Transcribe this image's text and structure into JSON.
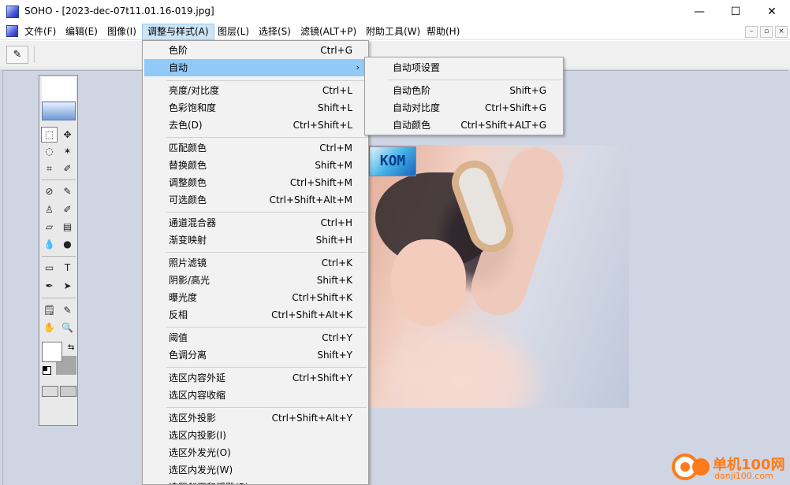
{
  "window": {
    "title": "SOHO - [2023-dec-07t11.01.16-019.jpg]",
    "minimize_glyph": "—",
    "maximize_glyph": "☐",
    "close_glyph": "✕"
  },
  "menubar": {
    "items": [
      {
        "label": "文件(F)"
      },
      {
        "label": "编辑(E)"
      },
      {
        "label": "图像(I)"
      },
      {
        "label": "调整与样式(A)",
        "active": true
      },
      {
        "label": "图层(L)"
      },
      {
        "label": "选择(S)"
      },
      {
        "label": "滤镜(ALT+P)"
      },
      {
        "label": "附助工具(W)"
      },
      {
        "label": "帮助(H)"
      }
    ],
    "mdi_minimize": "–",
    "mdi_restore": "▫",
    "mdi_close": "×"
  },
  "toolbar": {
    "tool_options_icon": "eyedropper-icon",
    "tool_options_glyph": "✎"
  },
  "toolbox": {
    "tools": [
      {
        "name": "rect-marquee-icon",
        "glyph": "⬚"
      },
      {
        "name": "move-icon",
        "glyph": "✥"
      },
      {
        "name": "lasso-icon",
        "glyph": "◌"
      },
      {
        "name": "magic-wand-icon",
        "glyph": "✶"
      },
      {
        "name": "crop-icon",
        "glyph": "⌗"
      },
      {
        "name": "color-sampler-icon",
        "glyph": "✐"
      },
      {
        "name": "healing-brush-icon",
        "glyph": "⊘"
      },
      {
        "name": "brush-icon",
        "glyph": "✎"
      },
      {
        "name": "clone-stamp-icon",
        "glyph": "♙"
      },
      {
        "name": "history-brush-icon",
        "glyph": "✐"
      },
      {
        "name": "eraser-icon",
        "glyph": "▱"
      },
      {
        "name": "gradient-icon",
        "glyph": "▤"
      },
      {
        "name": "blur-icon",
        "glyph": "💧"
      },
      {
        "name": "dodge-icon",
        "glyph": "●"
      },
      {
        "name": "shape-icon",
        "glyph": "▭"
      },
      {
        "name": "type-icon",
        "glyph": "T"
      },
      {
        "name": "pen-icon",
        "glyph": "✒"
      },
      {
        "name": "direct-select-icon",
        "glyph": "➤"
      },
      {
        "name": "notes-icon",
        "glyph": "🗒"
      },
      {
        "name": "eyedropper-icon",
        "glyph": "✎"
      },
      {
        "name": "hand-icon",
        "glyph": "✋"
      },
      {
        "name": "zoom-icon",
        "glyph": "🔍"
      }
    ],
    "swap_glyph": "⇆"
  },
  "dropdown": {
    "groups": [
      [
        {
          "label": "色阶",
          "shortcut": "Ctrl+G"
        },
        {
          "label": "自动",
          "shortcut": "",
          "submenu": true,
          "highlight": true
        }
      ],
      [
        {
          "label": "亮度/对比度",
          "shortcut": "Ctrl+L"
        },
        {
          "label": "色彩饱和度",
          "shortcut": "Shift+L"
        },
        {
          "label": "去色(D)",
          "shortcut": "Ctrl+Shift+L"
        }
      ],
      [
        {
          "label": "匹配颜色",
          "shortcut": "Ctrl+M"
        },
        {
          "label": "替换颜色",
          "shortcut": "Shift+M"
        },
        {
          "label": "调整颜色",
          "shortcut": "Ctrl+Shift+M"
        },
        {
          "label": "可选颜色",
          "shortcut": "Ctrl+Shift+Alt+M"
        }
      ],
      [
        {
          "label": "通道混合器",
          "shortcut": "Ctrl+H"
        },
        {
          "label": "渐变映射",
          "shortcut": "Shift+H"
        }
      ],
      [
        {
          "label": "照片滤镜",
          "shortcut": "Ctrl+K"
        },
        {
          "label": "阴影/高光",
          "shortcut": "Shift+K"
        },
        {
          "label": "曝光度",
          "shortcut": "Ctrl+Shift+K"
        },
        {
          "label": "反相",
          "shortcut": "Ctrl+Shift+Alt+K"
        }
      ],
      [
        {
          "label": "阈值",
          "shortcut": "Ctrl+Y"
        },
        {
          "label": "色调分离",
          "shortcut": "Shift+Y"
        }
      ],
      [
        {
          "label": "选区内容外延",
          "shortcut": "Ctrl+Shift+Y"
        },
        {
          "label": "选区内容收缩",
          "shortcut": ""
        }
      ],
      [
        {
          "label": "选区外投影",
          "shortcut": "Ctrl+Shift+Alt+Y"
        },
        {
          "label": "选区内投影(I)",
          "shortcut": ""
        },
        {
          "label": "选区外发光(O)",
          "shortcut": ""
        },
        {
          "label": "选区内发光(W)",
          "shortcut": ""
        },
        {
          "label": "选区斜面和浮雕(B)",
          "shortcut": ""
        }
      ]
    ],
    "submenu_arrow": "›"
  },
  "submenu": {
    "items": [
      {
        "label": "自动项设置",
        "shortcut": ""
      },
      {
        "label": "自动色阶",
        "shortcut": "Shift+G"
      },
      {
        "label": "自动对比度",
        "shortcut": "Ctrl+Shift+G"
      },
      {
        "label": "自动颜色",
        "shortcut": "Ctrl+Shift+ALT+G"
      }
    ]
  },
  "photo": {
    "logo_text": "KOM"
  },
  "watermark": {
    "name": "单机100网",
    "url": "danji100.com"
  },
  "colors": {
    "menu_highlight": "#91c9f7",
    "workspace": "#cfd5e3",
    "watermark": "#ff7a1a"
  }
}
